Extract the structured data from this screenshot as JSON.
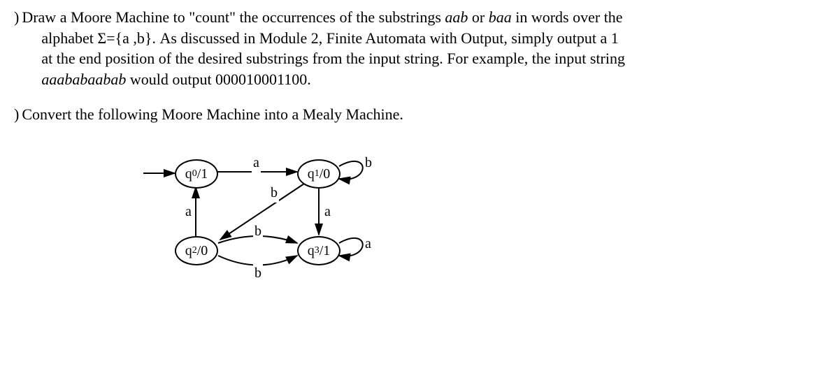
{
  "problem1": {
    "marker": ")",
    "text_line1_a": "Draw a Moore Machine to \"count\" the occurrences of the substrings ",
    "text_line1_b": "aab",
    "text_line1_c": " or ",
    "text_line1_d": "baa",
    "text_line1_e": " in words over the",
    "text_line2": "alphabet Σ={a ,b}. As discussed in Module 2, Finite Automata with Output, simply output a 1",
    "text_line3": "at the end position of the desired substrings from the input string. For example, the input string",
    "text_line4_a": "aaababaabab",
    "text_line4_b": " would output 000010001100."
  },
  "problem2": {
    "marker": ")",
    "text": "Convert the following Moore Machine into a Mealy Machine."
  },
  "diagram": {
    "states": {
      "q0": {
        "label_q": "q",
        "label_sub": "0",
        "label_out": "/1"
      },
      "q1": {
        "label_q": "q",
        "label_sub": "1",
        "label_out": "/0"
      },
      "q2": {
        "label_q": "q",
        "label_sub": "2",
        "label_out": "/0"
      },
      "q3": {
        "label_q": "q",
        "label_sub": "3",
        "label_out": "/1"
      }
    },
    "edges": {
      "q0_q1": "a",
      "q1_q1": "b",
      "q1_q3": "a",
      "q1_q2": "b",
      "q2_q0": "a",
      "q2_q3_top": "b",
      "q2_q3_bot": "b",
      "q3_q3": "a"
    }
  }
}
